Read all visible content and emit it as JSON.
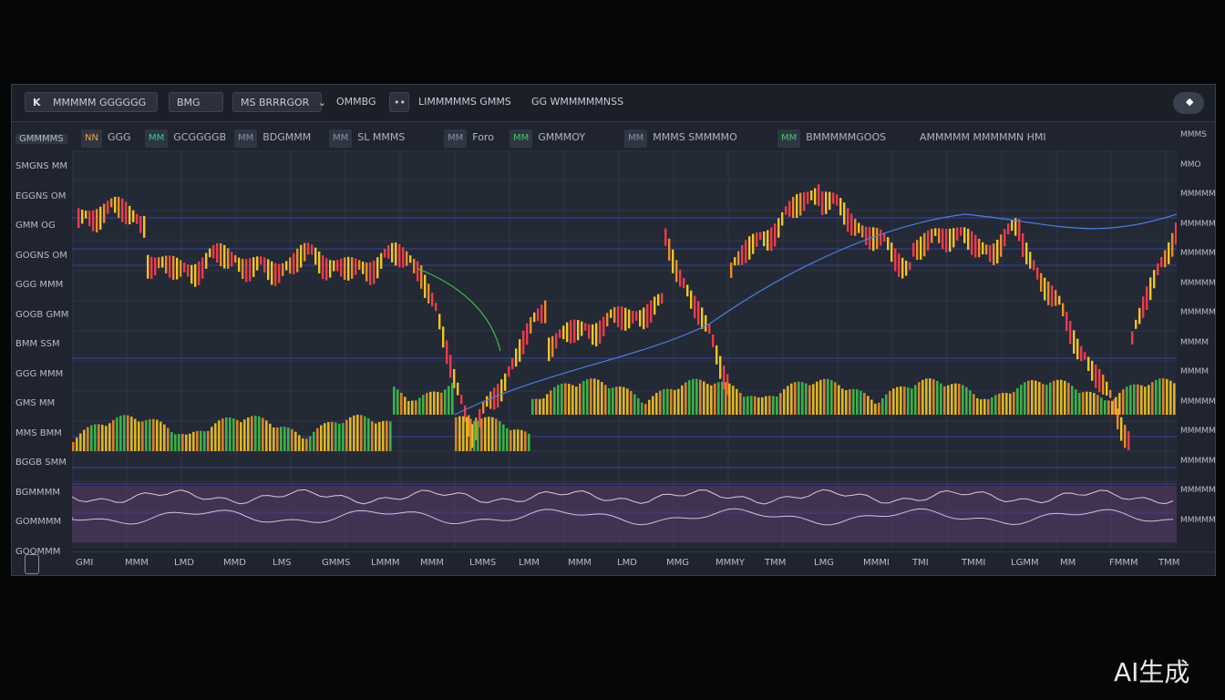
{
  "toolbar": {
    "logo": "K",
    "symbol_search": "MMMMM GGGGGG",
    "timeframe": "BMG",
    "chart_type": "MS BRRRGOR",
    "compare": "OMMBG",
    "pair_info": "LIMMMMMS GMMS",
    "volume_info": "GG WMMMMMNSS"
  },
  "indicators": [
    {
      "icon": "NN",
      "label": "GGG",
      "color": "#e8a23a"
    },
    {
      "icon": "MM",
      "label": "GCGGGGB",
      "color": "#3ac2a0"
    },
    {
      "icon": "MM",
      "label": "BDGMMM",
      "color": "#8a90a0"
    },
    {
      "icon": "MM",
      "label": "SL MMMS",
      "color": "#8a90a0"
    },
    {
      "icon": "MM",
      "label": "Foro",
      "color": "#8a90a0"
    },
    {
      "icon": "MM",
      "label": "GMMMOY",
      "color": "#4cc36a"
    },
    {
      "icon": "MM",
      "label": "MMMS SMMMMO",
      "color": "#8a90a0"
    },
    {
      "icon": "MM",
      "label": "BMMMMMGOOS",
      "color": "#4cc36a"
    },
    {
      "icon": "",
      "label": "AMMMMM MMMMMN HMI",
      "color": "#8a90a0"
    }
  ],
  "left_axis": {
    "header": "GMMMMS",
    "labels": [
      "SMGNS MM",
      "EGGNS OM",
      "GMM OG",
      "GOGNS OM",
      "GGG MMM",
      "GOGB GMM",
      "BMM SSM",
      "GGG MMM",
      "GMS MM",
      "MMS BMM",
      "BGGB SMM",
      "BGMMMM",
      "GOMMMM",
      "GOOMMM"
    ]
  },
  "right_axis": {
    "labels": [
      "MMMS",
      "MMO",
      "MMMMM",
      "MMMMM",
      "MMMMM",
      "MMMMM",
      "MMMMM",
      "MMMM",
      "MMMM",
      "MMMMM",
      "MMMMM",
      "MMMMM",
      "MMMMM",
      "MMMMM"
    ]
  },
  "bottom_axis": {
    "labels": [
      "GMI",
      "MMM",
      "LMD",
      "MMD",
      "LMS",
      "GMMS",
      "LMMM",
      "MMM",
      "LMMS",
      "LMM",
      "MMM",
      "LMD",
      "MMG",
      "MMMY",
      "TMM",
      "LMG",
      "MMMI",
      "TMI",
      "TMMI",
      "LGMM",
      "MM",
      "FMMM",
      "TMM"
    ]
  },
  "colors": {
    "candle_up": "#f2c522",
    "candle_down": "#ef3b4a",
    "candle_mid": "#f08a2c",
    "line_blue": "#4a7fe0",
    "line_green": "#3fbf4a",
    "grid": "#2f3544",
    "hline": "#3a4fd0",
    "osc_fill": "#5a3a6a"
  },
  "badge": "AI生成"
}
